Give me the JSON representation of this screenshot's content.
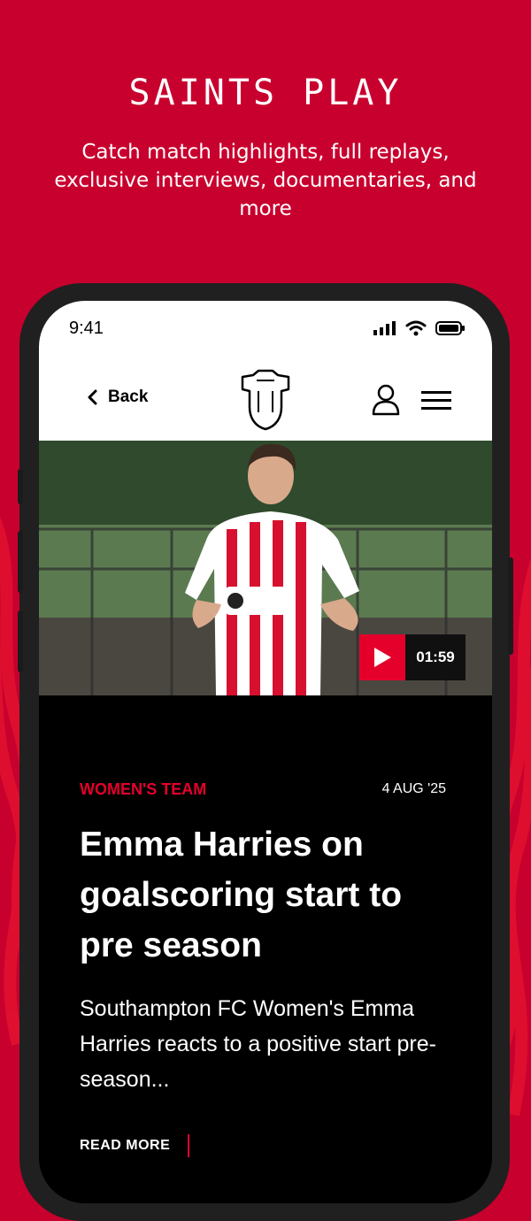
{
  "promo": {
    "title": "SAINTS PLAY",
    "subtitle": "Catch match highlights, full replays, exclusive interviews, documentaries, and more"
  },
  "status_bar": {
    "time": "9:41",
    "icons": [
      "cellular-signal-icon",
      "wifi-icon",
      "battery-icon"
    ]
  },
  "header": {
    "back_label": "Back",
    "logo": "club-crest-icon",
    "icons": [
      "account-icon",
      "menu-icon"
    ]
  },
  "video": {
    "duration": "01:59",
    "play_icon": "play-icon"
  },
  "article": {
    "category": "WOMEN'S TEAM",
    "date": "4 AUG '25",
    "headline": "Emma Harries on goalscoring start to pre season",
    "summary": "Southampton FC Women's Emma Harries reacts to a positive start pre-season...",
    "read_more": "READ MORE"
  },
  "colors": {
    "brand_red": "#c8002e",
    "accent_red": "#e4002b",
    "screen_black": "#000000"
  }
}
